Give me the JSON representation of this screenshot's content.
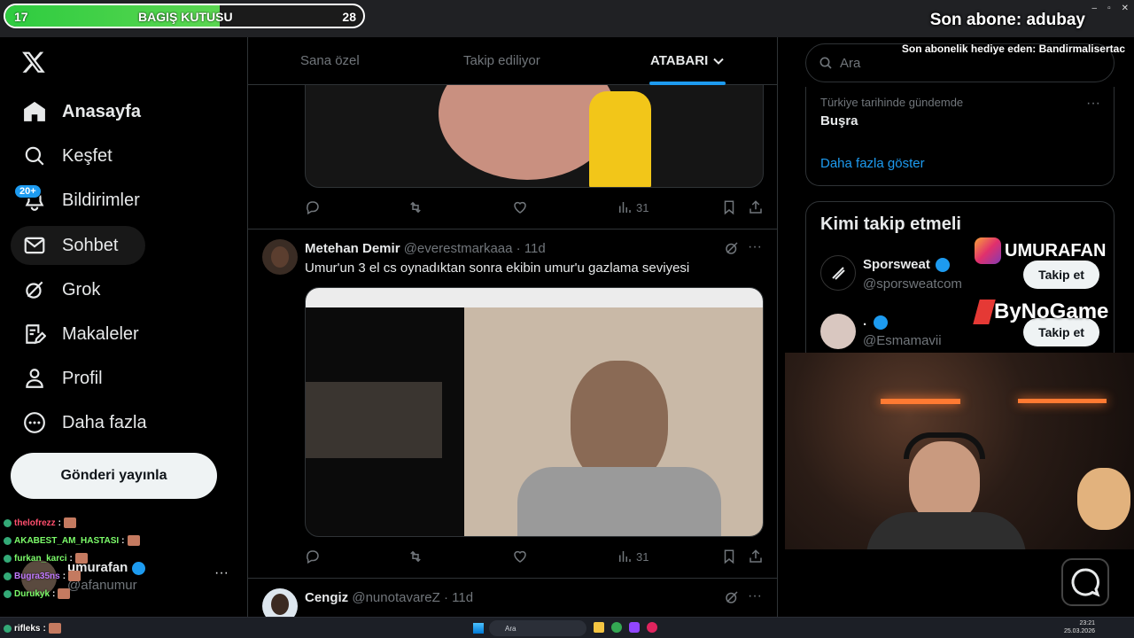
{
  "overlay": {
    "donation": {
      "left": "17",
      "label": "BAGIŞ KUTUSU",
      "right": "28",
      "fill_fraction": 0.6
    },
    "last_sub": "Son abone: adubay",
    "last_gift": "Son abonelik hediye eden: Bandirmalisertac",
    "instagram": "UMURAFAN",
    "sponsor": "ByNoGame"
  },
  "nav": {
    "items": [
      {
        "label": "Anasayfa",
        "icon": "home-icon"
      },
      {
        "label": "Keşfet",
        "icon": "search-icon"
      },
      {
        "label": "Bildirimler",
        "icon": "bell-icon"
      },
      {
        "label": "Sohbet",
        "icon": "mail-icon"
      },
      {
        "label": "Grok",
        "icon": "grok-icon"
      },
      {
        "label": "Makaleler",
        "icon": "articles-icon"
      },
      {
        "label": "Profil",
        "icon": "profile-icon"
      },
      {
        "label": "Daha fazla",
        "icon": "more-circle-icon"
      }
    ],
    "notif_badge": "20+",
    "post_button": "Gönderi yayınla",
    "account": {
      "name": "umurafan",
      "handle": "@afanumur"
    }
  },
  "chat": [
    {
      "user": "thelofrezz",
      "color": "#ff4f6e"
    },
    {
      "user": "AKABEST_AM_HASTASI",
      "color": "#7cfc6a"
    },
    {
      "user": "furkan_karci",
      "color": "#7cfc6a"
    },
    {
      "user": "Bugra35ns",
      "color": "#c27bff"
    },
    {
      "user": "Durukyk",
      "color": "#7cfc6a"
    },
    {
      "user": "rifleks",
      "color": "#ffffff"
    }
  ],
  "tabs": [
    {
      "label": "Sana özel"
    },
    {
      "label": "Takip ediliyor"
    },
    {
      "label": "ATABARI"
    }
  ],
  "tweets": [
    {
      "views": "31"
    },
    {
      "name": "Metehan Demir",
      "handle": "@everestmarkaaa",
      "time": "· 11d",
      "text": "Umur'un 3 el cs oynadıktan sonra ekibin umur'u gazlama seviyesi",
      "views": "31"
    },
    {
      "name": "Cengiz",
      "handle": "@nunotavareZ",
      "time": "· 11d"
    }
  ],
  "right": {
    "search_placeholder": "Ara",
    "trend": {
      "context": "Türkiye tarihinde gündemde",
      "title": "Buşra",
      "more": "Daha fazla göster"
    },
    "follow": {
      "title": "Kimi takip etmeli",
      "accounts": [
        {
          "name": "Sporsweat",
          "handle": "@sporsweatcom",
          "button": "Takip et"
        },
        {
          "name": ".",
          "handle": "@Esmamavii",
          "button": "Takip et"
        }
      ]
    }
  },
  "taskbar": {
    "search": "Ara",
    "time": "23:21",
    "date": "25.03.2026"
  }
}
